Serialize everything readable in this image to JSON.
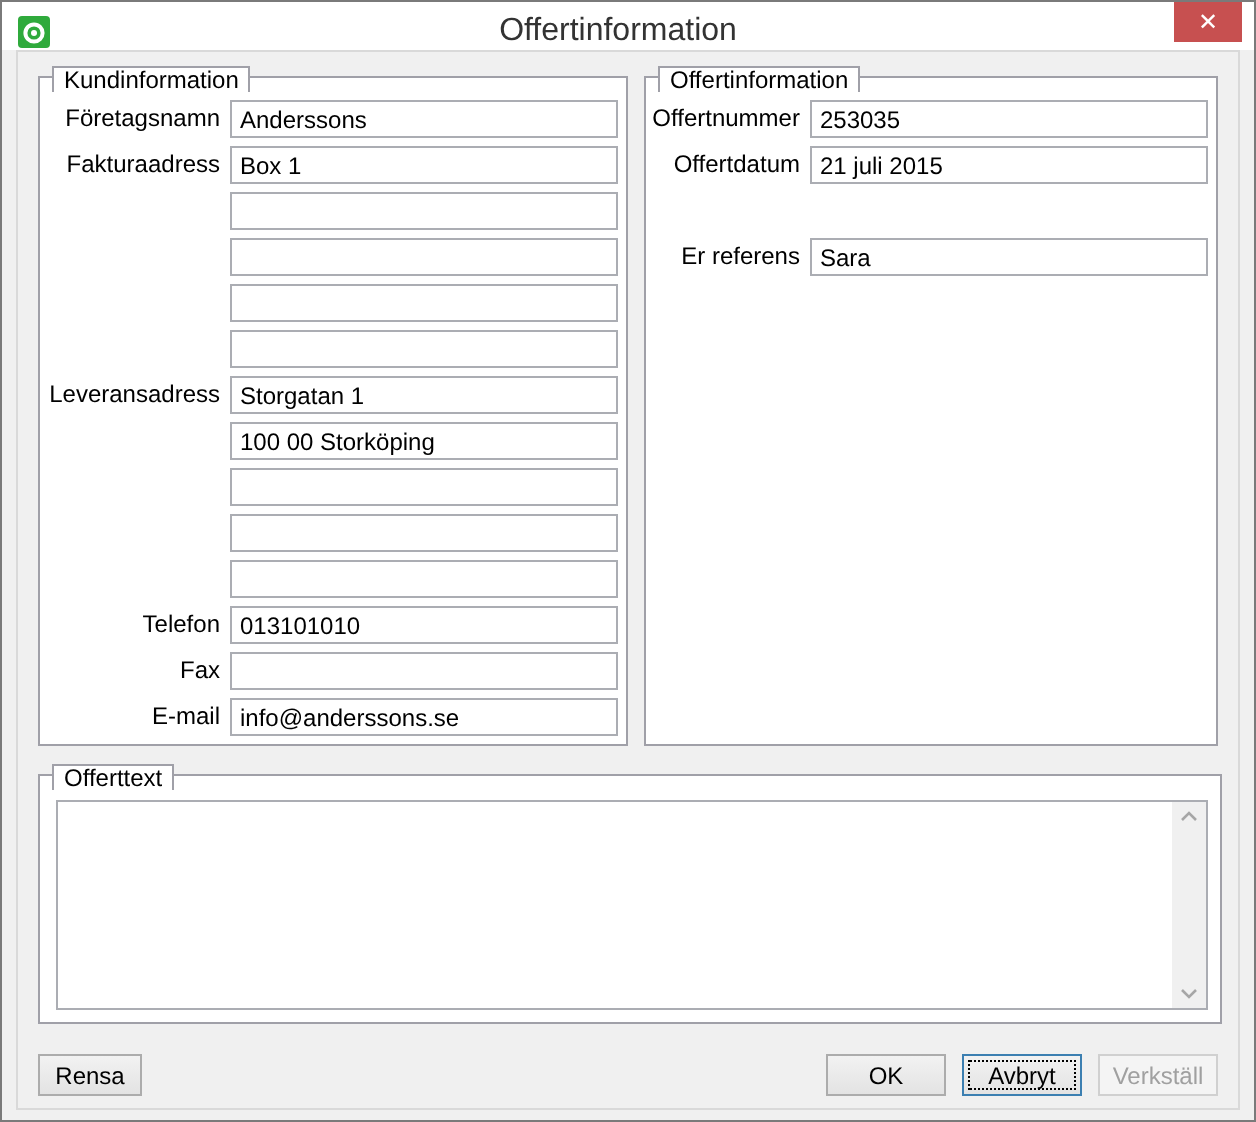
{
  "window": {
    "title": "Offertinformation",
    "close": "✕"
  },
  "customer": {
    "title": "Kundinformation",
    "rows": [
      {
        "label": "Företagsnamn",
        "value": "Anderssons"
      },
      {
        "label": "Fakturaadress",
        "value": "Box 1"
      },
      {
        "value": ""
      },
      {
        "value": ""
      },
      {
        "value": ""
      },
      {
        "value": ""
      },
      {
        "label": "Leveransadress",
        "value": "Storgatan 1"
      },
      {
        "value": "100 00 Storköping"
      },
      {
        "value": ""
      },
      {
        "value": ""
      },
      {
        "value": ""
      },
      {
        "label": "Telefon",
        "value": "013101010"
      },
      {
        "label": "Fax",
        "value": ""
      },
      {
        "label": "E-mail",
        "value": "info@anderssons.se"
      }
    ]
  },
  "offer": {
    "title": "Offertinformation",
    "rows": [
      {
        "label": "Offertnummer",
        "value": "253035"
      },
      {
        "label": "Offertdatum",
        "value": "21 juli 2015"
      },
      {
        "label": "Er referens",
        "value": "Sara"
      }
    ]
  },
  "offer_text": {
    "title": "Offerttext"
  },
  "buttons": [
    {
      "label": "Rensa",
      "disabled": false,
      "focused": false
    },
    {
      "label": "OK",
      "disabled": false,
      "focused": false
    },
    {
      "label": "Avbryt",
      "disabled": false,
      "focused": true
    },
    {
      "label": "Verkställ",
      "disabled": true,
      "focused": false
    }
  ]
}
